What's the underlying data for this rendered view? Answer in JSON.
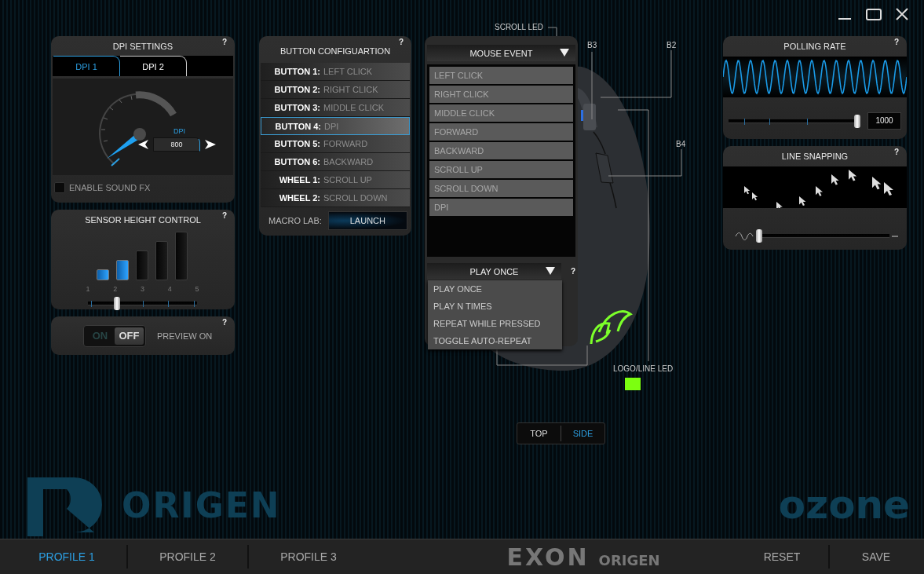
{
  "dpi_settings": {
    "title": "DPI SETTINGS",
    "help": "?",
    "tabs": [
      {
        "label": "DPI 1",
        "selected": true
      },
      {
        "label": "DPI 2",
        "selected": false
      }
    ],
    "dpi_label": "DPI",
    "dpi_value": "800",
    "sound_fx": {
      "label": "ENABLE SOUND FX",
      "checked": false
    }
  },
  "sensor_height": {
    "title": "SENSOR HEIGHT CONTROL",
    "help": "?",
    "steps": [
      {
        "label": "1",
        "lit": true
      },
      {
        "label": "2",
        "lit": true
      },
      {
        "label": "3",
        "lit": false
      },
      {
        "label": "4",
        "lit": false
      },
      {
        "label": "5",
        "lit": false
      }
    ],
    "slider": {
      "level": 0.25
    }
  },
  "preview": {
    "help": "?",
    "toggle": {
      "on_label": "ON",
      "off_label": "OFF",
      "on": false
    },
    "label": "PREVIEW ON"
  },
  "button_config": {
    "title": "BUTTON CONFIGUARTION",
    "help": "?",
    "rows": [
      {
        "button": "BUTTON 1:",
        "action": "LEFT CLICK",
        "selected": false
      },
      {
        "button": "BUTTON 2:",
        "action": "RIGHT CLICK",
        "selected": false
      },
      {
        "button": "BUTTON 3:",
        "action": "MIDDLE CLICK",
        "selected": false
      },
      {
        "button": "BUTTON 4:",
        "action": "DPI",
        "selected": true
      },
      {
        "button": "BUTTON 5:",
        "action": "FORWARD",
        "selected": false
      },
      {
        "button": "BUTTON 6:",
        "action": "BACKWARD",
        "selected": false
      },
      {
        "button": "WHEEL 1:",
        "action": "SCROLL UP",
        "selected": false
      },
      {
        "button": "WHEEL 2:",
        "action": "SCROLL DOWN",
        "selected": false
      }
    ],
    "macro_lab": {
      "label": "MACRO LAB:",
      "button": "LAUNCH"
    }
  },
  "mouse_event": {
    "dropdown": "MOUSE EVENT",
    "events": [
      "LEFT CLICK",
      "RIGHT CLICK",
      "MIDDLE CLICK",
      "FORWARD",
      "BACKWARD",
      "SCROLL UP",
      "SCROLL DOWN",
      "DPI"
    ],
    "repeat_dropdown": "PLAY ONCE",
    "help": "?",
    "repeat_options": [
      "PLAY ONCE",
      "PLAY N TIMES",
      "REPEAT WHILE PRESSED",
      "TOGGLE AUTO-REPEAT"
    ]
  },
  "callouts": [
    "SCROLL LED",
    "B3",
    "B2",
    "B4",
    "LOGO/LINE LED"
  ],
  "view_tabs": [
    {
      "label": "TOP",
      "selected": false
    },
    {
      "label": "SIDE",
      "selected": true
    }
  ],
  "polling_rate": {
    "title": "POLLING RATE",
    "help": "?",
    "slider": {
      "level": 1
    },
    "value": "1000"
  },
  "line_snapping": {
    "title": "LINE SNAPPING",
    "help": "?",
    "slider": {
      "level": 0
    }
  },
  "background_logos": [
    "ORIGEN",
    "ozone"
  ],
  "bottom_bar": {
    "profiles": [
      {
        "label": "PROFILE 1",
        "selected": true
      },
      {
        "label": "PROFILE 2",
        "selected": false
      },
      {
        "label": "PROFILE 3",
        "selected": false
      }
    ],
    "logo": [
      "EXON",
      "ORIGEN"
    ],
    "actions": [
      "RESET",
      "SAVE"
    ]
  }
}
